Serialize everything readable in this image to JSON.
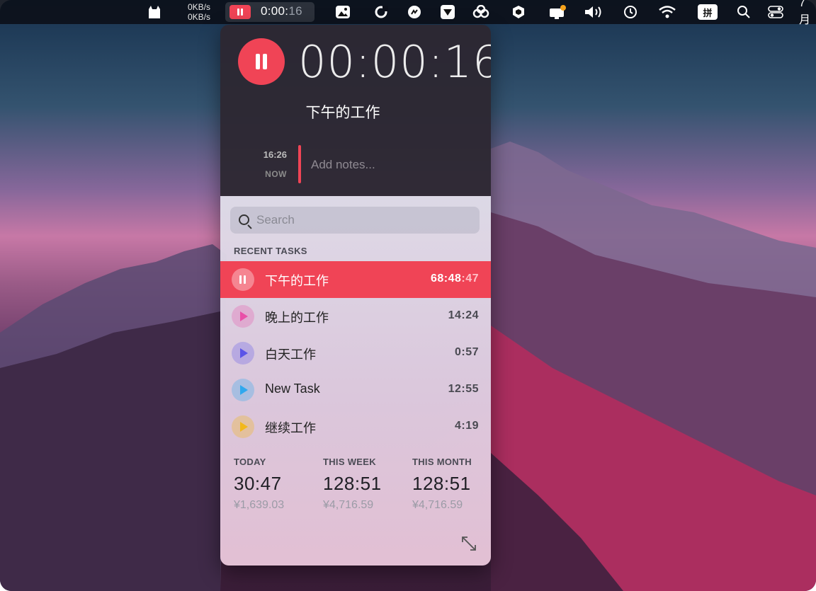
{
  "menubar": {
    "net_up": "0KB/s",
    "net_down": "0KB/s",
    "timer_main": "0:00:",
    "timer_dim": "16",
    "ime_label": "拼",
    "clock_partial": "7月"
  },
  "popover": {
    "elapsed": "00:00:16",
    "current_task": "下午的工作",
    "note_time": "16:26",
    "note_now": "NOW",
    "note_placeholder": "Add notes...",
    "search_placeholder": "Search",
    "recent_label": "RECENT TASKS",
    "tasks": [
      {
        "name": "下午的工作",
        "duration": "68:48",
        "duration_dim": ":47",
        "color": "#f04456",
        "active": true
      },
      {
        "name": "晚上的工作",
        "duration": "14:24",
        "duration_dim": "",
        "color": "#e94fa8"
      },
      {
        "name": "白天工作",
        "duration": "0:57",
        "duration_dim": "",
        "color": "#5b54e8"
      },
      {
        "name": "New Task",
        "duration": "12:55",
        "duration_dim": "",
        "color": "#2ea8ee"
      },
      {
        "name": "继续工作",
        "duration": "4:19",
        "duration_dim": "",
        "color": "#f2b81b"
      }
    ],
    "stats": [
      {
        "label": "TODAY",
        "value": "30:47",
        "money": "¥1,639.03"
      },
      {
        "label": "THIS WEEK",
        "value": "128:51",
        "money": "¥4,716.59"
      },
      {
        "label": "THIS MONTH",
        "value": "128:51",
        "money": "¥4,716.59"
      }
    ]
  },
  "icons": [
    "cat-icon",
    "photos-icon",
    "sync-icon",
    "chat-icon",
    "mail-icon",
    "creative-cloud-icon",
    "shield-icon",
    "display-icon",
    "volume-icon",
    "time-machine-icon",
    "wifi-icon",
    "search-icon",
    "control-center-icon",
    "expand-icon"
  ],
  "colors": {
    "accent": "#f04456"
  }
}
